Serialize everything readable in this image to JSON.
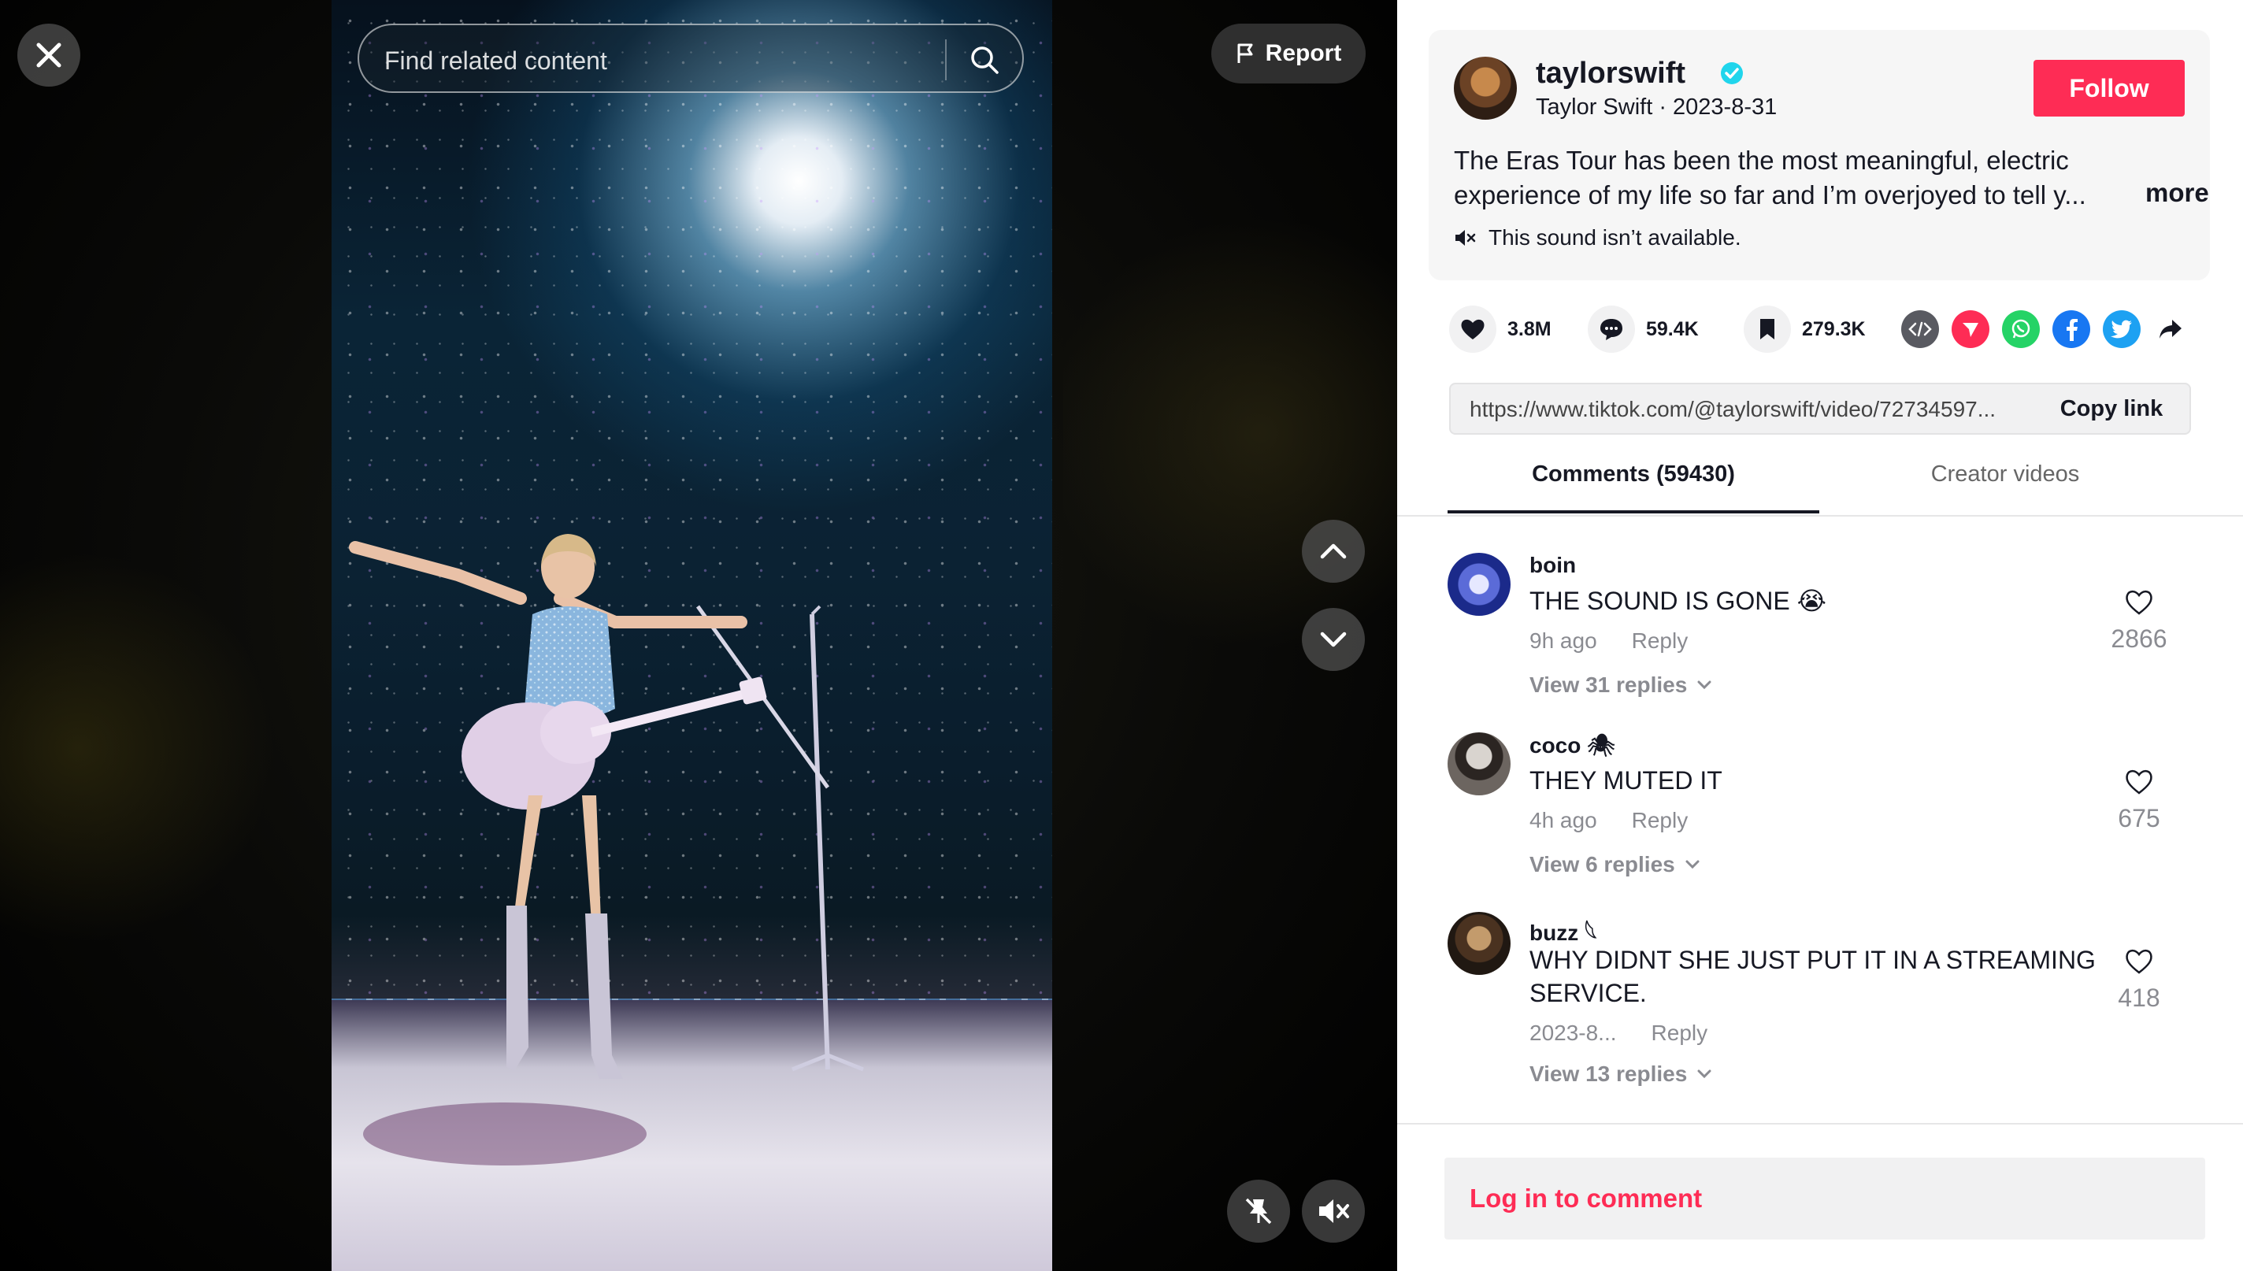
{
  "search": {
    "placeholder": "Find related content"
  },
  "video_overlay": {
    "report_label": "Report"
  },
  "post": {
    "username": "taylorswift",
    "nickname_date": "Taylor Swift · 2023-8-31",
    "follow_label": "Follow",
    "description": "The Eras Tour has been the most meaningful, electric experience of my life so far and I’m overjoyed to tell y...",
    "more_label": "more",
    "sound_status": "This sound isn’t available."
  },
  "stats": {
    "likes": "3.8M",
    "comments": "59.4K",
    "saves": "279.3K"
  },
  "share_icons": [
    "embed-icon",
    "send-icon",
    "whatsapp-icon",
    "facebook-icon",
    "twitter-icon",
    "share-arrow-icon"
  ],
  "link": {
    "url": "https://www.tiktok.com/@taylorswift/video/72734597...",
    "copy_label": "Copy link"
  },
  "tabs": {
    "comments": "Comments (59430)",
    "creator": "Creator videos"
  },
  "comments": [
    {
      "user": "boin",
      "text": "THE SOUND IS GONE 😭",
      "time": "9h ago",
      "reply": "Reply",
      "view_replies": "View 31 replies",
      "likes": "2866"
    },
    {
      "user": "coco 🕷",
      "text": "THEY MUTED IT",
      "time": "4h ago",
      "reply": "Reply",
      "view_replies": "View 6 replies",
      "likes": "675"
    },
    {
      "user": "buzz 𓆩",
      "text": "WHY DIDNT SHE JUST PUT IT IN A STREAMING SERVICE.",
      "time": "2023-8...",
      "reply": "Reply",
      "view_replies": "View 13 replies",
      "likes": "418"
    }
  ],
  "login": {
    "label": "Log in to comment"
  },
  "colors": {
    "accent": "#fe2c55",
    "verified": "#20d5ec",
    "panel_bg": "#ffffff",
    "card_bg": "#f6f6f6"
  }
}
